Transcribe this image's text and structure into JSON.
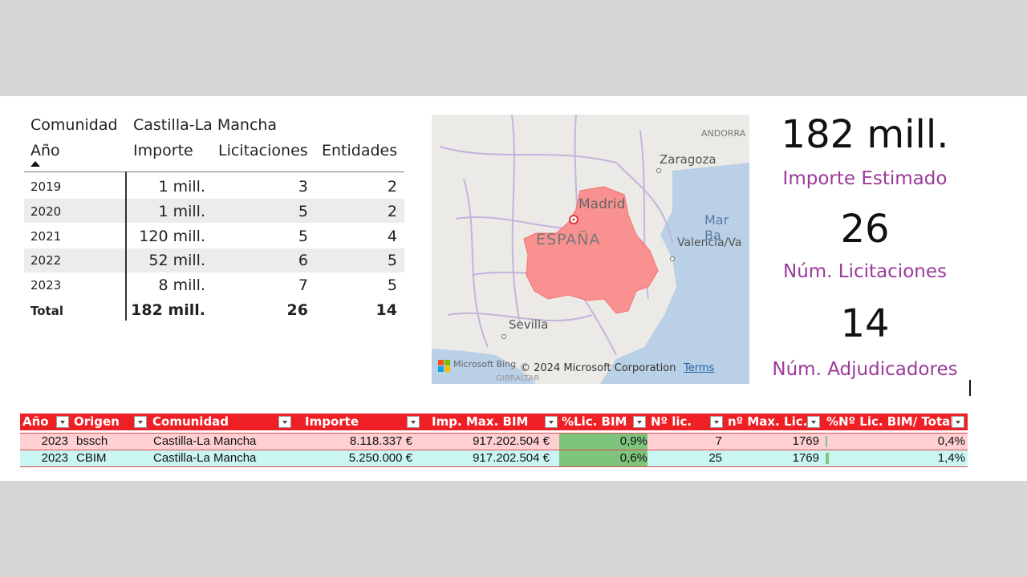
{
  "pivot": {
    "comunidad_label": "Comunidad",
    "comunidad_value": "Castilla-La Mancha",
    "headers": {
      "anio": "Año",
      "importe": "Importe",
      "licitaciones": "Licitaciones",
      "entidades": "Entidades"
    },
    "rows": [
      {
        "anio": "2019",
        "importe": "1 mill.",
        "licitaciones": "3",
        "entidades": "2"
      },
      {
        "anio": "2020",
        "importe": "1 mill.",
        "licitaciones": "5",
        "entidades": "2"
      },
      {
        "anio": "2021",
        "importe": "120 mill.",
        "licitaciones": "5",
        "entidades": "4"
      },
      {
        "anio": "2022",
        "importe": "52 mill.",
        "licitaciones": "6",
        "entidades": "5"
      },
      {
        "anio": "2023",
        "importe": "8 mill.",
        "licitaciones": "7",
        "entidades": "5"
      }
    ],
    "total": {
      "label": "Total",
      "importe": "182 mill.",
      "licitaciones": "26",
      "entidades": "14"
    }
  },
  "map": {
    "labels": [
      "ANDORRA",
      "Zaragoza",
      "Madrid",
      "Mar Ba",
      "ESPAÑA",
      "Valencia/Va",
      "Sevilla",
      "GIBRALTAR"
    ],
    "copyright": "© 2024 Microsoft Corporation",
    "terms": "Terms",
    "bing": "Microsoft Bing",
    "region_color": "#f99190"
  },
  "kpis": [
    {
      "value": "182 mill.",
      "label": "Importe Estimado"
    },
    {
      "value": "26",
      "label": "Núm. Licitaciones"
    },
    {
      "value": "14",
      "label": "Núm. Adjudicadores"
    }
  ],
  "excel": {
    "headers": [
      "Año",
      "Origen",
      "Comunidad",
      "Importe",
      "Imp. Max. BIM",
      "%Lic. BIM",
      "Nº lic.",
      "nº Max. Lic.",
      "%Nº Lic. BIM/ Total"
    ],
    "rows": [
      {
        "anio": "2023",
        "origen": "bssch",
        "comunidad": "Castilla-La Mancha",
        "importe": "8.118.337 €",
        "max_bim": "917.202.504 €",
        "pct_bim": "0,9%",
        "n_lic": "7",
        "max_lic": "1769",
        "pct_total": "0,4%",
        "bar_fraction": 0.004
      },
      {
        "anio": "2023",
        "origen": "CBIM",
        "comunidad": "Castilla-La Mancha",
        "importe": "5.250.000 €",
        "max_bim": "917.202.504 €",
        "pct_bim": "0,6%",
        "n_lic": "25",
        "max_lic": "1769",
        "pct_total": "1,4%",
        "bar_fraction": 0.014
      }
    ],
    "colors": {
      "header": "#ee1f25",
      "row1": "#ffcfd1",
      "row2": "#c9f6f2",
      "green": "#7fc47d"
    }
  }
}
